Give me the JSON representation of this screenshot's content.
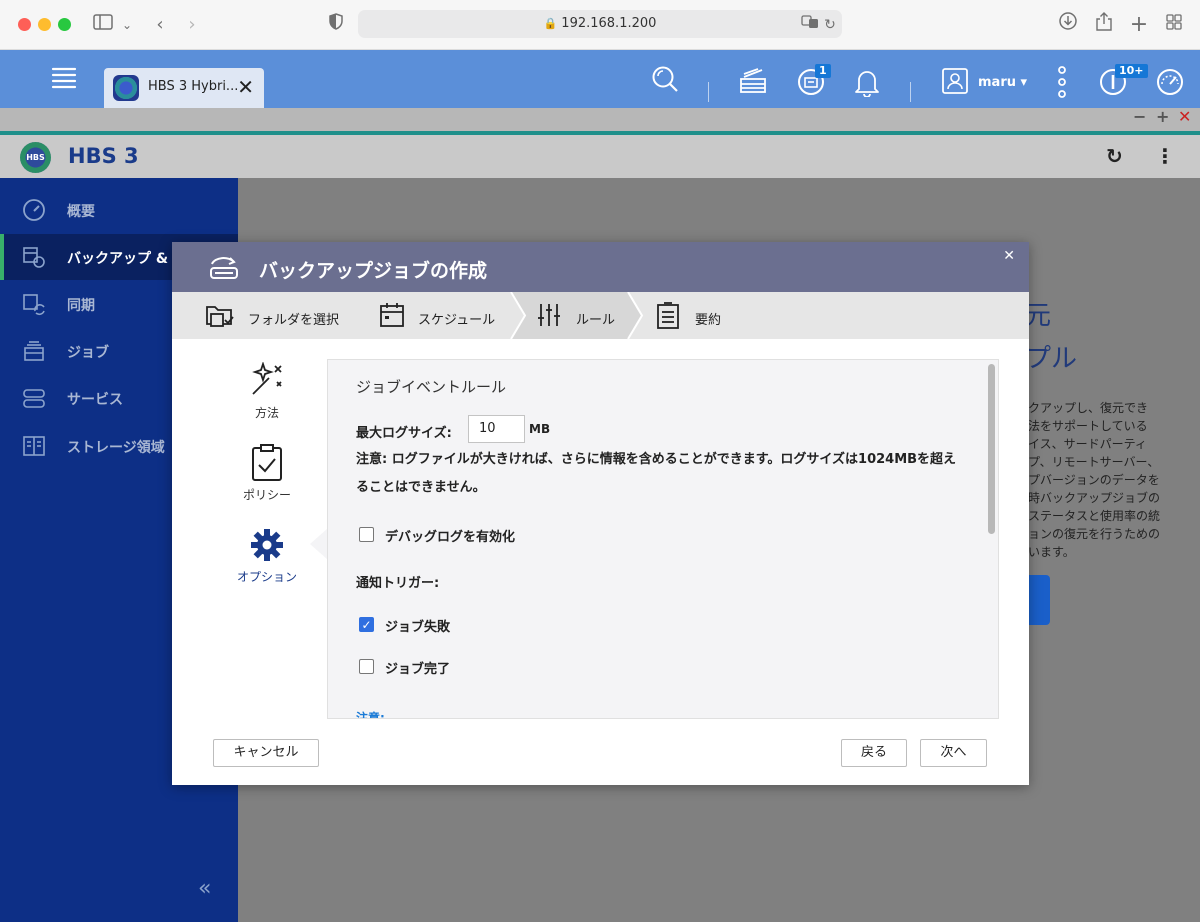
{
  "browser": {
    "url": "192.168.1.200"
  },
  "qts": {
    "tab_title": "HBS 3 Hybri...",
    "user": "maru",
    "badge_tasks": "1",
    "badge_notifications": "10+"
  },
  "app": {
    "title": "HBS 3",
    "logo_text": "HBS"
  },
  "sidebar": {
    "items": [
      {
        "label": "概要",
        "icon": "dashboard-icon"
      },
      {
        "label": "バックアップ & 復元",
        "icon": "backup-icon"
      },
      {
        "label": "同期",
        "icon": "sync-icon"
      },
      {
        "label": "ジョブ",
        "icon": "jobs-icon"
      },
      {
        "label": "サービス",
        "icon": "services-icon"
      },
      {
        "label": "ストレージ領域",
        "icon": "storage-space-icon"
      }
    ],
    "active_index": 1
  },
  "background": {
    "big1": "元",
    "big2": "プル",
    "lines": [
      "クアップし、復元でき",
      "法をサポートしている",
      "イス、サードパーティ",
      "プ、リモートサーバー、",
      "プバージョンのデータを",
      "時バックアップジョブの",
      "ステータスと使用率の統",
      "ョンの復元を行うための",
      "います。"
    ]
  },
  "dialog": {
    "title": "バックアップジョブの作成",
    "steps": [
      {
        "label": "フォルダを選択",
        "icon": "folder-icon"
      },
      {
        "label": "スケジュール",
        "icon": "calendar-icon"
      },
      {
        "label": "ルール",
        "icon": "sliders-icon"
      },
      {
        "label": "要約",
        "icon": "summary-icon"
      }
    ],
    "active_step": 2,
    "side_tabs": [
      {
        "label": "方法",
        "icon": "magic-wand-icon"
      },
      {
        "label": "ポリシー",
        "icon": "clipboard-check-icon"
      },
      {
        "label": "オプション",
        "icon": "gear-icon"
      }
    ],
    "active_side_tab": 2,
    "panel": {
      "heading": "ジョブイベントルール",
      "max_log_label": "最大ログサイズ:",
      "max_log_value": "10",
      "max_log_unit": "MB",
      "note_line1": "注意: ログファイルが大きければ、さらに情報を含めることができます。ログサイズは1024MBを超え",
      "note_line2": "ることはできません。",
      "debug_label": "デバッグログを有効化",
      "debug_checked": false,
      "notify_label": "通知トリガー:",
      "job_failed_label": "ジョブ失敗",
      "job_failed_checked": true,
      "job_done_label": "ジョブ完了",
      "job_done_checked": false,
      "note_link": "注意:"
    },
    "buttons": {
      "cancel": "キャンセル",
      "back": "戻る",
      "next": "次へ"
    }
  }
}
